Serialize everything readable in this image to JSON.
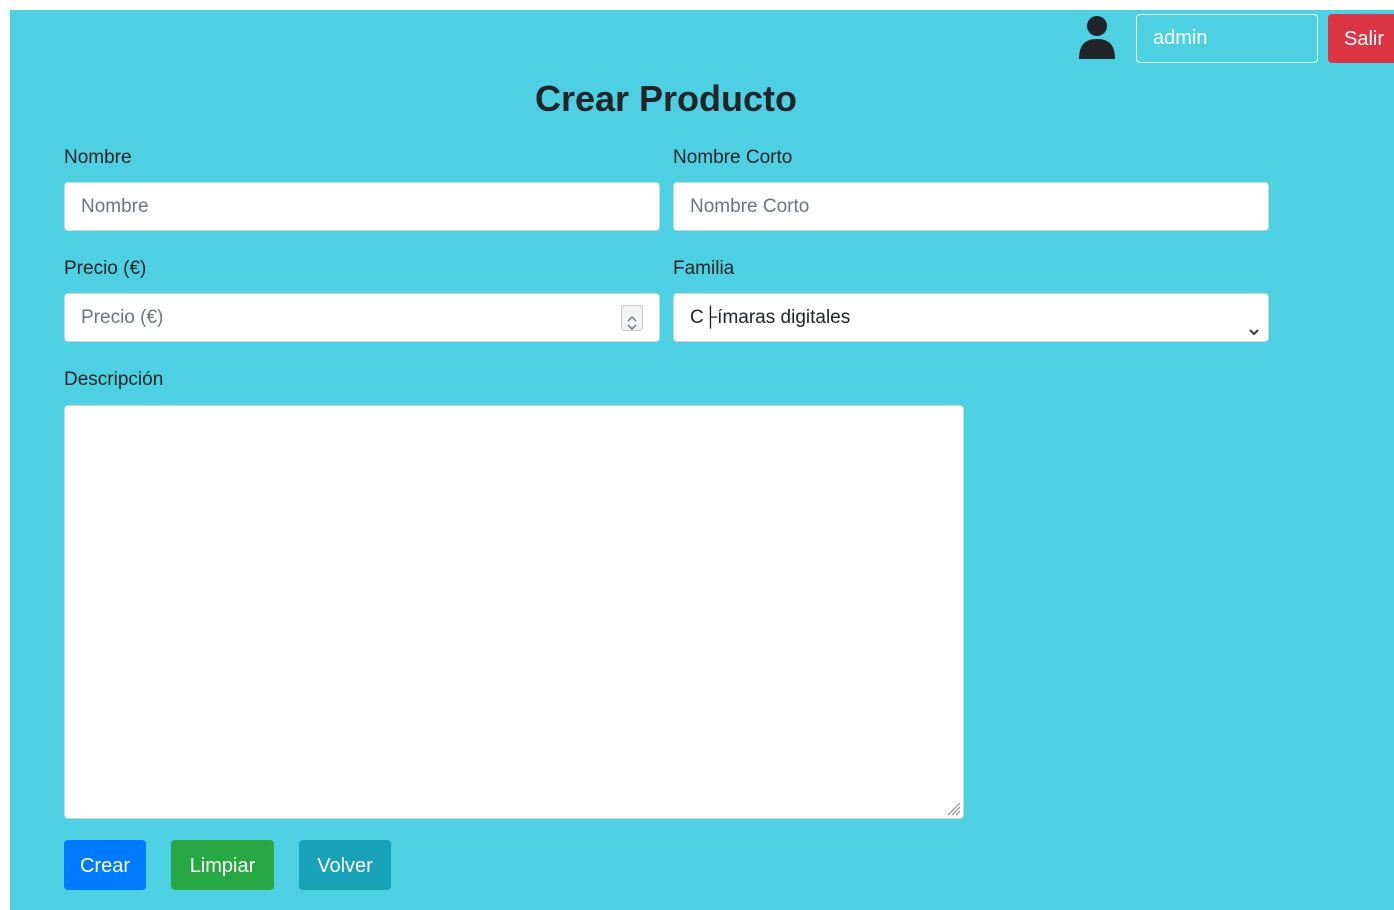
{
  "header": {
    "user_field_value": "admin",
    "logout_label": "Salir"
  },
  "page": {
    "title": "Crear Producto"
  },
  "form": {
    "name": {
      "label": "Nombre",
      "placeholder": "Nombre"
    },
    "short_name": {
      "label": "Nombre Corto",
      "placeholder": "Nombre Corto"
    },
    "price": {
      "label": "Precio (€)",
      "placeholder": "Precio (€)"
    },
    "family": {
      "label": "Familia",
      "selected_value": "C├ímaras digitales"
    },
    "description": {
      "label": "Descripción",
      "value": ""
    }
  },
  "actions": {
    "create_label": "Crear",
    "clear_label": "Limpiar",
    "back_label": "Volver"
  },
  "colors": {
    "background": "#4dd0e1",
    "danger": "#dc3545",
    "primary": "#007bff",
    "success": "#28a745",
    "info": "#17a2b8"
  },
  "icons": {
    "user": "user-icon",
    "stepper": "spinner-arrows-icon",
    "select": "chevron-down-icon",
    "resize": "resize-grip-icon"
  }
}
